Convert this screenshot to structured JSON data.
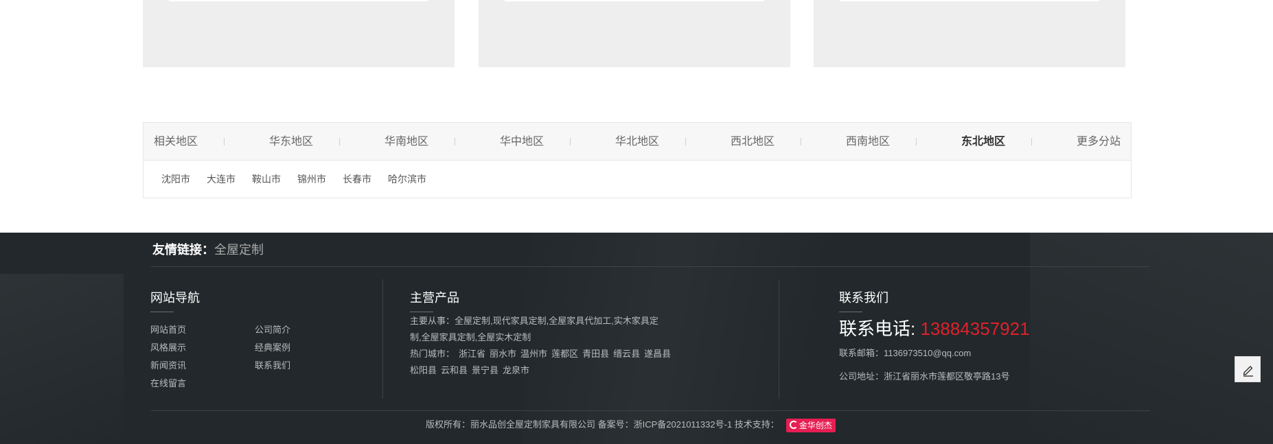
{
  "region": {
    "tabs": [
      {
        "label": "相关地区",
        "active": false
      },
      {
        "label": "华东地区",
        "active": false
      },
      {
        "label": "华南地区",
        "active": false
      },
      {
        "label": "华中地区",
        "active": false
      },
      {
        "label": "华北地区",
        "active": false
      },
      {
        "label": "西北地区",
        "active": false
      },
      {
        "label": "西南地区",
        "active": false
      },
      {
        "label": "东北地区",
        "active": true
      },
      {
        "label": "更多分站",
        "active": false
      }
    ],
    "cities": [
      "沈阳市",
      "大连市",
      "鞍山市",
      "锦州市",
      "长春市",
      "哈尔滨市"
    ]
  },
  "footer": {
    "links_label": "友情链接：",
    "link": "全屋定制",
    "nav": {
      "title": "网站导航",
      "items": [
        "网站首页",
        "公司简介",
        "风格展示",
        "经典案例",
        "新闻资讯",
        "联系我们",
        "在线留言"
      ]
    },
    "products": {
      "title": "主营产品",
      "main_label": "主要从事：",
      "main_line1": "全屋定制,现代家具定制,全屋家具代加工,实木家具定",
      "main_line2": "制,全屋家具定制,全屋实木定制",
      "cities_label": "热门城市：",
      "cities_row1": [
        "浙江省",
        "丽水市",
        "温州市",
        "莲都区",
        "青田县",
        "缙云县",
        "遂昌县"
      ],
      "cities_row2": [
        "松阳县",
        "云和县",
        "景宁县",
        "龙泉市"
      ]
    },
    "contact": {
      "title": "联系我们",
      "phone_label": "联系电话:",
      "phone": "13884357921",
      "email_label": "联系邮箱：",
      "email": "1136973510@qq.com",
      "address_label": "公司地址：",
      "address": "浙江省丽水市莲都区敬亭路13号"
    },
    "copyright": "版权所有：丽水品创全屋定制家具有限公司 备案号：浙ICP备2021011332号-1 技术支持：",
    "support_logo": "金华创杰"
  },
  "colors": {
    "footer_bg": "#22282b",
    "accent_red": "#e0212b",
    "logo_pink": "#e61e52"
  }
}
